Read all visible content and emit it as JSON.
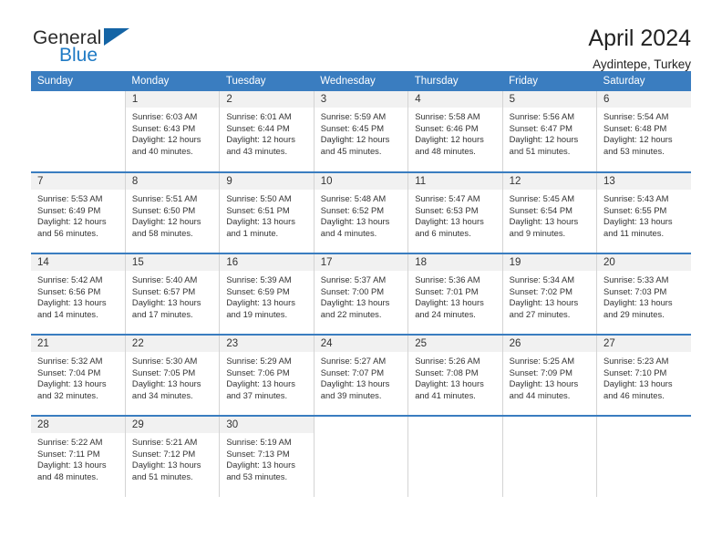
{
  "brand": {
    "name_top": "General",
    "name_bottom": "Blue",
    "accent_color": "#1f7ac4",
    "triangle_color": "#1464a5"
  },
  "header": {
    "title": "April 2024",
    "subtitle": "Aydintepe, Turkey"
  },
  "calendar": {
    "header_bg": "#3a7dc0",
    "weekday_headers": [
      "Sunday",
      "Monday",
      "Tuesday",
      "Wednesday",
      "Thursday",
      "Friday",
      "Saturday"
    ],
    "weeks": [
      [
        {
          "empty": true
        },
        {
          "date": "1",
          "sunrise": "Sunrise: 6:03 AM",
          "sunset": "Sunset: 6:43 PM",
          "daylight": "Daylight: 12 hours and 40 minutes."
        },
        {
          "date": "2",
          "sunrise": "Sunrise: 6:01 AM",
          "sunset": "Sunset: 6:44 PM",
          "daylight": "Daylight: 12 hours and 43 minutes."
        },
        {
          "date": "3",
          "sunrise": "Sunrise: 5:59 AM",
          "sunset": "Sunset: 6:45 PM",
          "daylight": "Daylight: 12 hours and 45 minutes."
        },
        {
          "date": "4",
          "sunrise": "Sunrise: 5:58 AM",
          "sunset": "Sunset: 6:46 PM",
          "daylight": "Daylight: 12 hours and 48 minutes."
        },
        {
          "date": "5",
          "sunrise": "Sunrise: 5:56 AM",
          "sunset": "Sunset: 6:47 PM",
          "daylight": "Daylight: 12 hours and 51 minutes."
        },
        {
          "date": "6",
          "sunrise": "Sunrise: 5:54 AM",
          "sunset": "Sunset: 6:48 PM",
          "daylight": "Daylight: 12 hours and 53 minutes."
        }
      ],
      [
        {
          "date": "7",
          "sunrise": "Sunrise: 5:53 AM",
          "sunset": "Sunset: 6:49 PM",
          "daylight": "Daylight: 12 hours and 56 minutes."
        },
        {
          "date": "8",
          "sunrise": "Sunrise: 5:51 AM",
          "sunset": "Sunset: 6:50 PM",
          "daylight": "Daylight: 12 hours and 58 minutes."
        },
        {
          "date": "9",
          "sunrise": "Sunrise: 5:50 AM",
          "sunset": "Sunset: 6:51 PM",
          "daylight": "Daylight: 13 hours and 1 minute."
        },
        {
          "date": "10",
          "sunrise": "Sunrise: 5:48 AM",
          "sunset": "Sunset: 6:52 PM",
          "daylight": "Daylight: 13 hours and 4 minutes."
        },
        {
          "date": "11",
          "sunrise": "Sunrise: 5:47 AM",
          "sunset": "Sunset: 6:53 PM",
          "daylight": "Daylight: 13 hours and 6 minutes."
        },
        {
          "date": "12",
          "sunrise": "Sunrise: 5:45 AM",
          "sunset": "Sunset: 6:54 PM",
          "daylight": "Daylight: 13 hours and 9 minutes."
        },
        {
          "date": "13",
          "sunrise": "Sunrise: 5:43 AM",
          "sunset": "Sunset: 6:55 PM",
          "daylight": "Daylight: 13 hours and 11 minutes."
        }
      ],
      [
        {
          "date": "14",
          "sunrise": "Sunrise: 5:42 AM",
          "sunset": "Sunset: 6:56 PM",
          "daylight": "Daylight: 13 hours and 14 minutes."
        },
        {
          "date": "15",
          "sunrise": "Sunrise: 5:40 AM",
          "sunset": "Sunset: 6:57 PM",
          "daylight": "Daylight: 13 hours and 17 minutes."
        },
        {
          "date": "16",
          "sunrise": "Sunrise: 5:39 AM",
          "sunset": "Sunset: 6:59 PM",
          "daylight": "Daylight: 13 hours and 19 minutes."
        },
        {
          "date": "17",
          "sunrise": "Sunrise: 5:37 AM",
          "sunset": "Sunset: 7:00 PM",
          "daylight": "Daylight: 13 hours and 22 minutes."
        },
        {
          "date": "18",
          "sunrise": "Sunrise: 5:36 AM",
          "sunset": "Sunset: 7:01 PM",
          "daylight": "Daylight: 13 hours and 24 minutes."
        },
        {
          "date": "19",
          "sunrise": "Sunrise: 5:34 AM",
          "sunset": "Sunset: 7:02 PM",
          "daylight": "Daylight: 13 hours and 27 minutes."
        },
        {
          "date": "20",
          "sunrise": "Sunrise: 5:33 AM",
          "sunset": "Sunset: 7:03 PM",
          "daylight": "Daylight: 13 hours and 29 minutes."
        }
      ],
      [
        {
          "date": "21",
          "sunrise": "Sunrise: 5:32 AM",
          "sunset": "Sunset: 7:04 PM",
          "daylight": "Daylight: 13 hours and 32 minutes."
        },
        {
          "date": "22",
          "sunrise": "Sunrise: 5:30 AM",
          "sunset": "Sunset: 7:05 PM",
          "daylight": "Daylight: 13 hours and 34 minutes."
        },
        {
          "date": "23",
          "sunrise": "Sunrise: 5:29 AM",
          "sunset": "Sunset: 7:06 PM",
          "daylight": "Daylight: 13 hours and 37 minutes."
        },
        {
          "date": "24",
          "sunrise": "Sunrise: 5:27 AM",
          "sunset": "Sunset: 7:07 PM",
          "daylight": "Daylight: 13 hours and 39 minutes."
        },
        {
          "date": "25",
          "sunrise": "Sunrise: 5:26 AM",
          "sunset": "Sunset: 7:08 PM",
          "daylight": "Daylight: 13 hours and 41 minutes."
        },
        {
          "date": "26",
          "sunrise": "Sunrise: 5:25 AM",
          "sunset": "Sunset: 7:09 PM",
          "daylight": "Daylight: 13 hours and 44 minutes."
        },
        {
          "date": "27",
          "sunrise": "Sunrise: 5:23 AM",
          "sunset": "Sunset: 7:10 PM",
          "daylight": "Daylight: 13 hours and 46 minutes."
        }
      ],
      [
        {
          "date": "28",
          "sunrise": "Sunrise: 5:22 AM",
          "sunset": "Sunset: 7:11 PM",
          "daylight": "Daylight: 13 hours and 48 minutes."
        },
        {
          "date": "29",
          "sunrise": "Sunrise: 5:21 AM",
          "sunset": "Sunset: 7:12 PM",
          "daylight": "Daylight: 13 hours and 51 minutes."
        },
        {
          "date": "30",
          "sunrise": "Sunrise: 5:19 AM",
          "sunset": "Sunset: 7:13 PM",
          "daylight": "Daylight: 13 hours and 53 minutes."
        },
        {
          "empty": true
        },
        {
          "empty": true
        },
        {
          "empty": true
        },
        {
          "empty": true
        }
      ]
    ]
  }
}
